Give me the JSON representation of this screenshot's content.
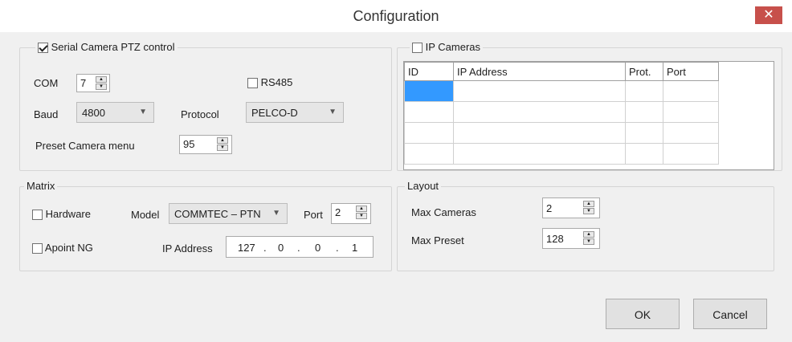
{
  "window": {
    "title": "Configuration",
    "close_glyph": "✕"
  },
  "serial": {
    "checkbox_label": "Serial Camera PTZ control",
    "checked": true,
    "com_label": "COM",
    "com_value": "7",
    "rs485_label": "RS485",
    "baud_label": "Baud",
    "baud_value": "4800",
    "protocol_label": "Protocol",
    "protocol_value": "PELCO-D",
    "preset_label": "Preset Camera menu",
    "preset_value": "95"
  },
  "ip_cameras": {
    "checkbox_label": "IP Cameras",
    "columns": [
      "ID",
      "IP Address",
      "Prot.",
      "Port"
    ],
    "rows": [
      [
        "",
        "",
        "",
        ""
      ],
      [
        "",
        "",
        "",
        ""
      ],
      [
        "",
        "",
        "",
        ""
      ],
      [
        "",
        "",
        "",
        ""
      ]
    ]
  },
  "matrix": {
    "group_label": "Matrix",
    "hardware_label": "Hardware",
    "model_label": "Model",
    "model_value": "COMMTEC – PTN",
    "port_label": "Port",
    "port_value": "2",
    "apoint_label": "Apoint NG",
    "ip_label": "IP Address",
    "ip_octets": [
      "127",
      "0",
      "0",
      "1"
    ]
  },
  "layout": {
    "group_label": "Layout",
    "max_cameras_label": "Max Cameras",
    "max_cameras_value": "2",
    "max_preset_label": "Max Preset",
    "max_preset_value": "128"
  },
  "buttons": {
    "ok": "OK",
    "cancel": "Cancel"
  },
  "colors": {
    "close_button": "#c7504b",
    "selection": "#3399ff"
  }
}
